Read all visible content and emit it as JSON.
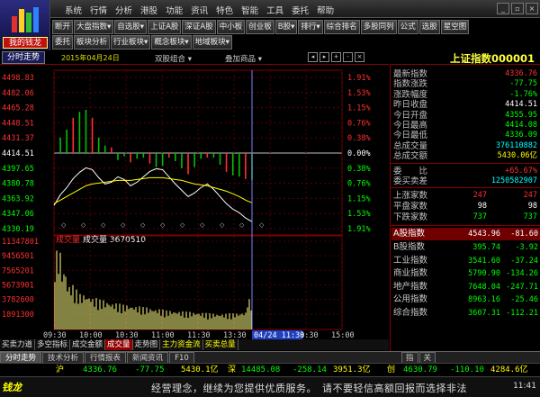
{
  "app": {
    "brand": "我的钱龙"
  },
  "menu": [
    "系统",
    "行情",
    "分析",
    "港股",
    "功能",
    "资讯",
    "特色",
    "智能",
    "工具",
    "委托",
    "帮助"
  ],
  "window_controls": [
    "_",
    "▫",
    "×"
  ],
  "toolbar1": [
    "断开",
    "大盘指数▾",
    "自选股▾",
    "上证A股",
    "深证A股",
    "中小板",
    "创业板",
    "B股▾",
    "排行▾",
    "综合排名",
    "多股同列",
    "公式",
    "选股",
    "星空图"
  ],
  "toolbar2": [
    "委托",
    "板块分析",
    "行业板块▾",
    "概念板块▾",
    "地域板块▾"
  ],
  "chart_header": {
    "tab": "分时走势",
    "date": "2015年04月24日",
    "mode": "双股组合 ▾",
    "overlay": "叠加商品 ▾",
    "nav": [
      "◂",
      "▸",
      "+",
      "-",
      "×"
    ]
  },
  "quote_title": "上证指数000001",
  "quote": [
    {
      "k": "最新指数",
      "v": "4336.76",
      "c": "#ff3030"
    },
    {
      "k": "指数涨跌",
      "v": "-77.75",
      "c": "#00ff00"
    },
    {
      "k": "涨跌幅度",
      "v": "-1.76%",
      "c": "#00ff00"
    },
    {
      "k": "昨日收盘",
      "v": "4414.51",
      "c": "#ffffff"
    },
    {
      "k": "今日开盘",
      "v": "4355.95",
      "c": "#00ff00"
    },
    {
      "k": "今日最高",
      "v": "4414.08",
      "c": "#00ff00"
    },
    {
      "k": "今日最低",
      "v": "4336.09",
      "c": "#00ff00"
    },
    {
      "k": "总成交量",
      "v": "376110882",
      "c": "#00ffff"
    },
    {
      "k": "总成交额",
      "v": "5430.06亿",
      "c": "#ffff00"
    }
  ],
  "quote2": [
    {
      "k": "委　　比",
      "v": "+65.67%",
      "c": "#ff3030"
    },
    {
      "k": "委买卖差",
      "v": "1250582907",
      "c": "#00ffff"
    }
  ],
  "breadth": [
    {
      "k": "上涨家数",
      "v1": "247",
      "c1": "#ff3030",
      "v2": "247",
      "c2": "#ff3030"
    },
    {
      "k": "平盘家数",
      "v1": "98",
      "c1": "#ffffff",
      "v2": "98",
      "c2": "#ffffff"
    },
    {
      "k": "下跌家数",
      "v1": "737",
      "c1": "#00ff00",
      "v2": "737",
      "c2": "#00ff00"
    }
  ],
  "indices": [
    {
      "k": "A股指数",
      "v1": "4543.96",
      "v2": "-81.60"
    },
    {
      "k": "B股指数",
      "v1": "395.74",
      "v2": "-3.92"
    },
    {
      "k": "工业指数",
      "v1": "3541.60",
      "v2": "-37.24"
    },
    {
      "k": "商业指数",
      "v1": "5790.90",
      "v2": "-134.26"
    },
    {
      "k": "地产指数",
      "v1": "7648.04",
      "v2": "-247.71"
    },
    {
      "k": "公用指数",
      "v1": "8963.16",
      "v2": "-25.46"
    },
    {
      "k": "综合指数",
      "v1": "3607.31",
      "v2": "-112.21"
    }
  ],
  "chart_data": {
    "type": "line",
    "price_axis": {
      "left": [
        "4498.83",
        "4482.06",
        "4465.28",
        "4448.51",
        "4431.37",
        "4414.51",
        "4397.65",
        "4380.78",
        "4363.92",
        "4347.06",
        "4330.19"
      ],
      "right": [
        "1.91%",
        "1.53%",
        "1.15%",
        "0.76%",
        "0.38%",
        "0.00%",
        "0.38%",
        "0.76%",
        "1.15%",
        "1.53%",
        "1.91%"
      ]
    },
    "volume_axis": [
      "11347801",
      "9456501",
      "7565201",
      "5673901",
      "3782600",
      "1891300"
    ],
    "volume_label": "成交量",
    "volume_value": "成交量 3670510",
    "x_ticks": [
      "09:30",
      "10:00",
      "10:30",
      "11:00",
      "11:30",
      "13:30",
      "14:00",
      "14:30",
      "15:00"
    ],
    "cursor_label": "04/24 11:30",
    "price": [
      4356,
      4368,
      4376,
      4386,
      4393,
      4398,
      4396,
      4387,
      4380,
      4382,
      4388,
      4385,
      4378,
      4382,
      4388,
      4394,
      4397,
      4396,
      4388,
      4380,
      4373,
      4366,
      4370,
      4376,
      4380,
      4374,
      4366,
      4358,
      4352,
      4348,
      4342,
      4338
    ],
    "avg": [
      4358,
      4362,
      4366,
      4370,
      4374,
      4378,
      4380,
      4381,
      4382,
      4383,
      4384,
      4384,
      4384,
      4385,
      4386,
      4387,
      4387,
      4387,
      4386,
      4385,
      4384,
      4382,
      4380,
      4379,
      4378,
      4376,
      4374,
      4372,
      4369,
      4366,
      4362,
      4359
    ],
    "volume": [
      9500000,
      7200000,
      5400000,
      4800000,
      4300000,
      4100000,
      3800000,
      3600000,
      3400000,
      3200000,
      3100000,
      3000000,
      2900000,
      2800000,
      2700000,
      2600000,
      2500000,
      2400000,
      2300000,
      2250000,
      2200000,
      2150000,
      2100000,
      2050000,
      2000000,
      1950000,
      1900000,
      1900000,
      1950000,
      2000000,
      2100000,
      3670510
    ]
  },
  "bottom_tabs": [
    "买卖力道",
    "多空指标",
    "成交金额",
    "成交量",
    "走势图",
    "主力资金流",
    "买卖总量"
  ],
  "bottom_tabs2": [
    "分时走势",
    "技术分析",
    "行情报表",
    "新闻资讯",
    "F10"
  ],
  "bottom_right_tabs": [
    "指",
    "关"
  ],
  "status": {
    "sh_label": "沪",
    "sh_price": "4336.76",
    "sh_chg": "-77.75",
    "sh_amt": "5430.1亿",
    "sz_label": "深",
    "sz_price": "14485.08",
    "sz_chg": "-258.14",
    "sz_amt": "3951.3亿",
    "cy_label": "创",
    "cy_price": "4630.79",
    "cy_chg": "-110.10",
    "cy_amt": "4284.6亿"
  },
  "ticker": {
    "logo": "钱龙",
    "message": "经营理念，继续为您提供优质服务。　请不要轻信高额回报而选择非法",
    "time": "11:41"
  }
}
